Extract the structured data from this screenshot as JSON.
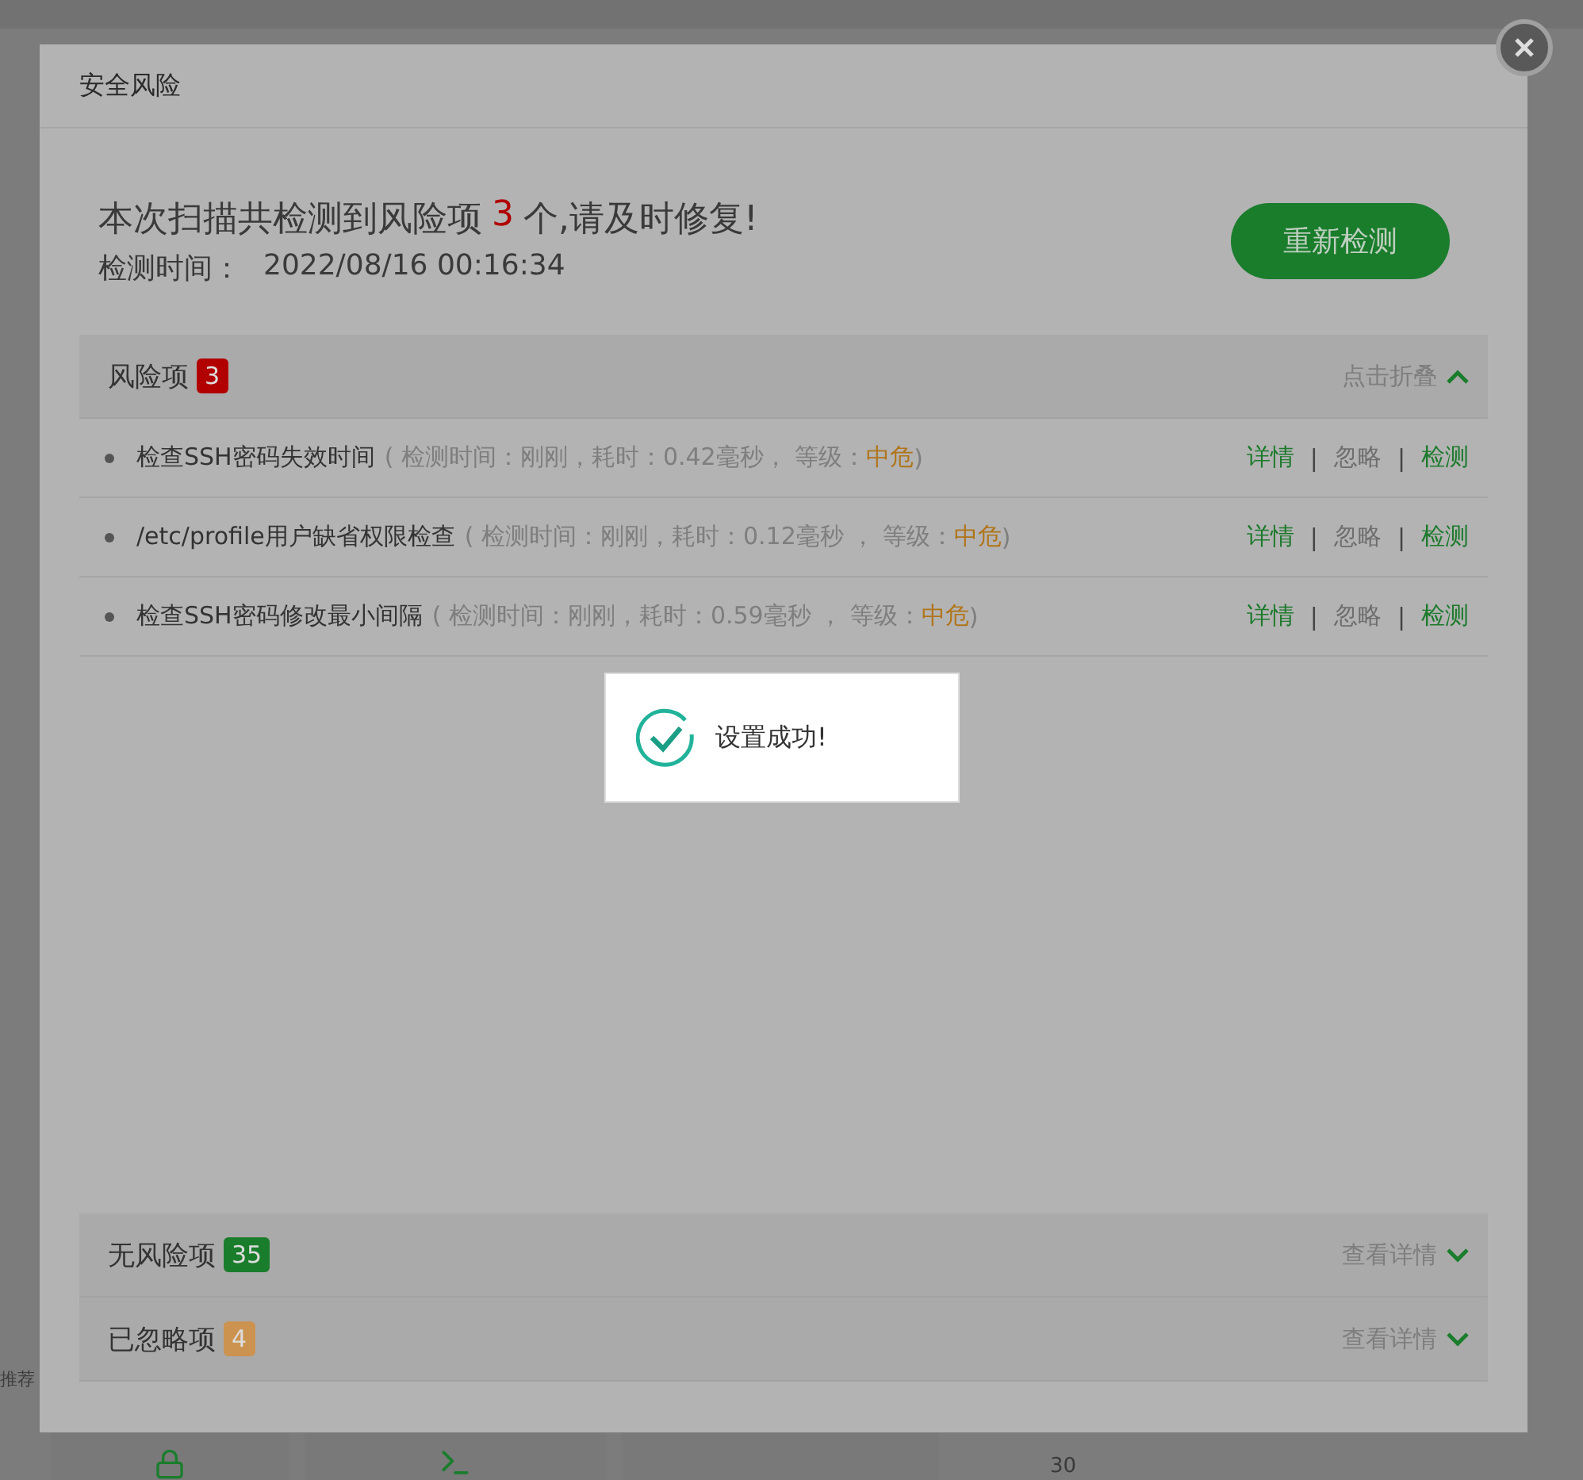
{
  "background_page": {
    "side_label": "推荐",
    "axis_tick": "30"
  },
  "dialog": {
    "title": "安全风险",
    "summary": {
      "headline_before": "本次扫描共检测到风险项",
      "headline_count": "3",
      "headline_after": "个,请及时修复!",
      "time_label": "检测时间：",
      "time_value": "2022/08/16 00:16:34"
    },
    "rescan_button": "重新检测",
    "sections": [
      {
        "title": "风险项",
        "count": "3",
        "color": "#b20000",
        "toggle": "点击折叠",
        "expanded": true,
        "items": [
          {
            "name": "检查SSH密码失效时间",
            "detail": "( 检测时间：刚刚，耗时：0.42毫秒， 等级：",
            "level": "中危",
            "detail_end": ")",
            "actions": [
              {
                "label": "详情",
                "kind": "link"
              },
              {
                "label": "|",
                "kind": "separator"
              },
              {
                "label": "忽略",
                "kind": "muted"
              },
              {
                "label": "|",
                "kind": "separator"
              },
              {
                "label": "检测",
                "kind": "link"
              }
            ]
          },
          {
            "name": "/etc/profile用户缺省权限检查",
            "detail": "( 检测时间：刚刚，耗时：0.12毫秒 ， 等级：",
            "level": "中危",
            "detail_end": ")",
            "actions": [
              {
                "label": "详情",
                "kind": "link"
              },
              {
                "label": "|",
                "kind": "separator"
              },
              {
                "label": "忽略",
                "kind": "muted"
              },
              {
                "label": "|",
                "kind": "separator"
              },
              {
                "label": "检测",
                "kind": "link"
              }
            ]
          },
          {
            "name": "检查SSH密码修改最小间隔",
            "detail": "( 检测时间：刚刚，耗时：0.59毫秒 ， 等级：",
            "level": "中危",
            "detail_end": ")",
            "actions": [
              {
                "label": "详情",
                "kind": "link"
              },
              {
                "label": "|",
                "kind": "separator"
              },
              {
                "label": "忽略",
                "kind": "muted"
              },
              {
                "label": "|",
                "kind": "separator"
              },
              {
                "label": "检测",
                "kind": "link"
              }
            ]
          }
        ]
      },
      {
        "title": "无风险项",
        "count": "35",
        "color": "#1a7d2c",
        "toggle": "查看详情",
        "expanded": false
      },
      {
        "title": "已忽略项",
        "count": "4",
        "color": "#cc9350",
        "toggle": "查看详情",
        "expanded": false
      }
    ]
  },
  "toast": {
    "message": "设置成功!"
  }
}
